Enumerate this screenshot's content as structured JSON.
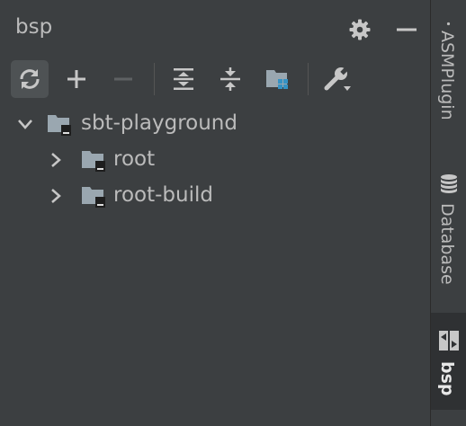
{
  "header": {
    "title": "bsp"
  },
  "toolbar": {
    "buttons": [
      "refresh-icon",
      "plus-icon",
      "minus-icon",
      "expand-all-icon",
      "collapse-all-icon",
      "project-structure-icon",
      "wrench-icon"
    ]
  },
  "tree": {
    "items": [
      {
        "label": "sbt-playground",
        "expanded": true,
        "level": 0
      },
      {
        "label": "root",
        "expanded": false,
        "level": 1
      },
      {
        "label": "root-build",
        "expanded": false,
        "level": 1
      }
    ]
  },
  "sidebar": {
    "tabs": [
      {
        "label": "ASMPlugin",
        "icon": "plugin-icon",
        "active": false
      },
      {
        "label": "Database",
        "icon": "database-icon",
        "active": false
      },
      {
        "label": "bsp",
        "icon": "bsp-icon",
        "active": true
      }
    ]
  },
  "colors": {
    "background": "#3c3f41",
    "text": "#bbbbbb",
    "accent_blue": "#3592c4",
    "active_tab_bg": "#2f3133"
  }
}
